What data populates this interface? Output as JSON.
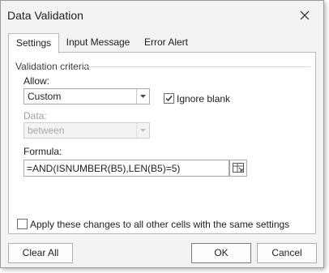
{
  "window": {
    "title": "Data Validation"
  },
  "tabs": [
    {
      "label": "Settings",
      "active": true
    },
    {
      "label": "Input Message",
      "active": false
    },
    {
      "label": "Error Alert",
      "active": false
    }
  ],
  "criteria": {
    "group_label": "Validation criteria",
    "allow_label": "Allow:",
    "allow_value": "Custom",
    "ignore_blank_label": "Ignore blank",
    "ignore_blank_checked": true,
    "data_label": "Data:",
    "data_value": "between",
    "data_enabled": false,
    "formula_label": "Formula:",
    "formula_value": "=AND(ISNUMBER(B5),LEN(B5)=5)"
  },
  "apply_all": {
    "label": "Apply these changes to all other cells with the same settings",
    "checked": false
  },
  "buttons": {
    "clear_all": "Clear All",
    "ok": "OK",
    "cancel": "Cancel"
  },
  "colors": {
    "dialog_bg": "#f3f3f3",
    "panel_bg": "#ffffff",
    "border": "#a8a8a8",
    "disabled_text": "#a0a0a0"
  },
  "icons": {
    "close": "close-icon",
    "dropdown": "chevron-down-icon",
    "checkmark": "checkmark-icon",
    "cell_reference": "cell-reference-icon"
  }
}
